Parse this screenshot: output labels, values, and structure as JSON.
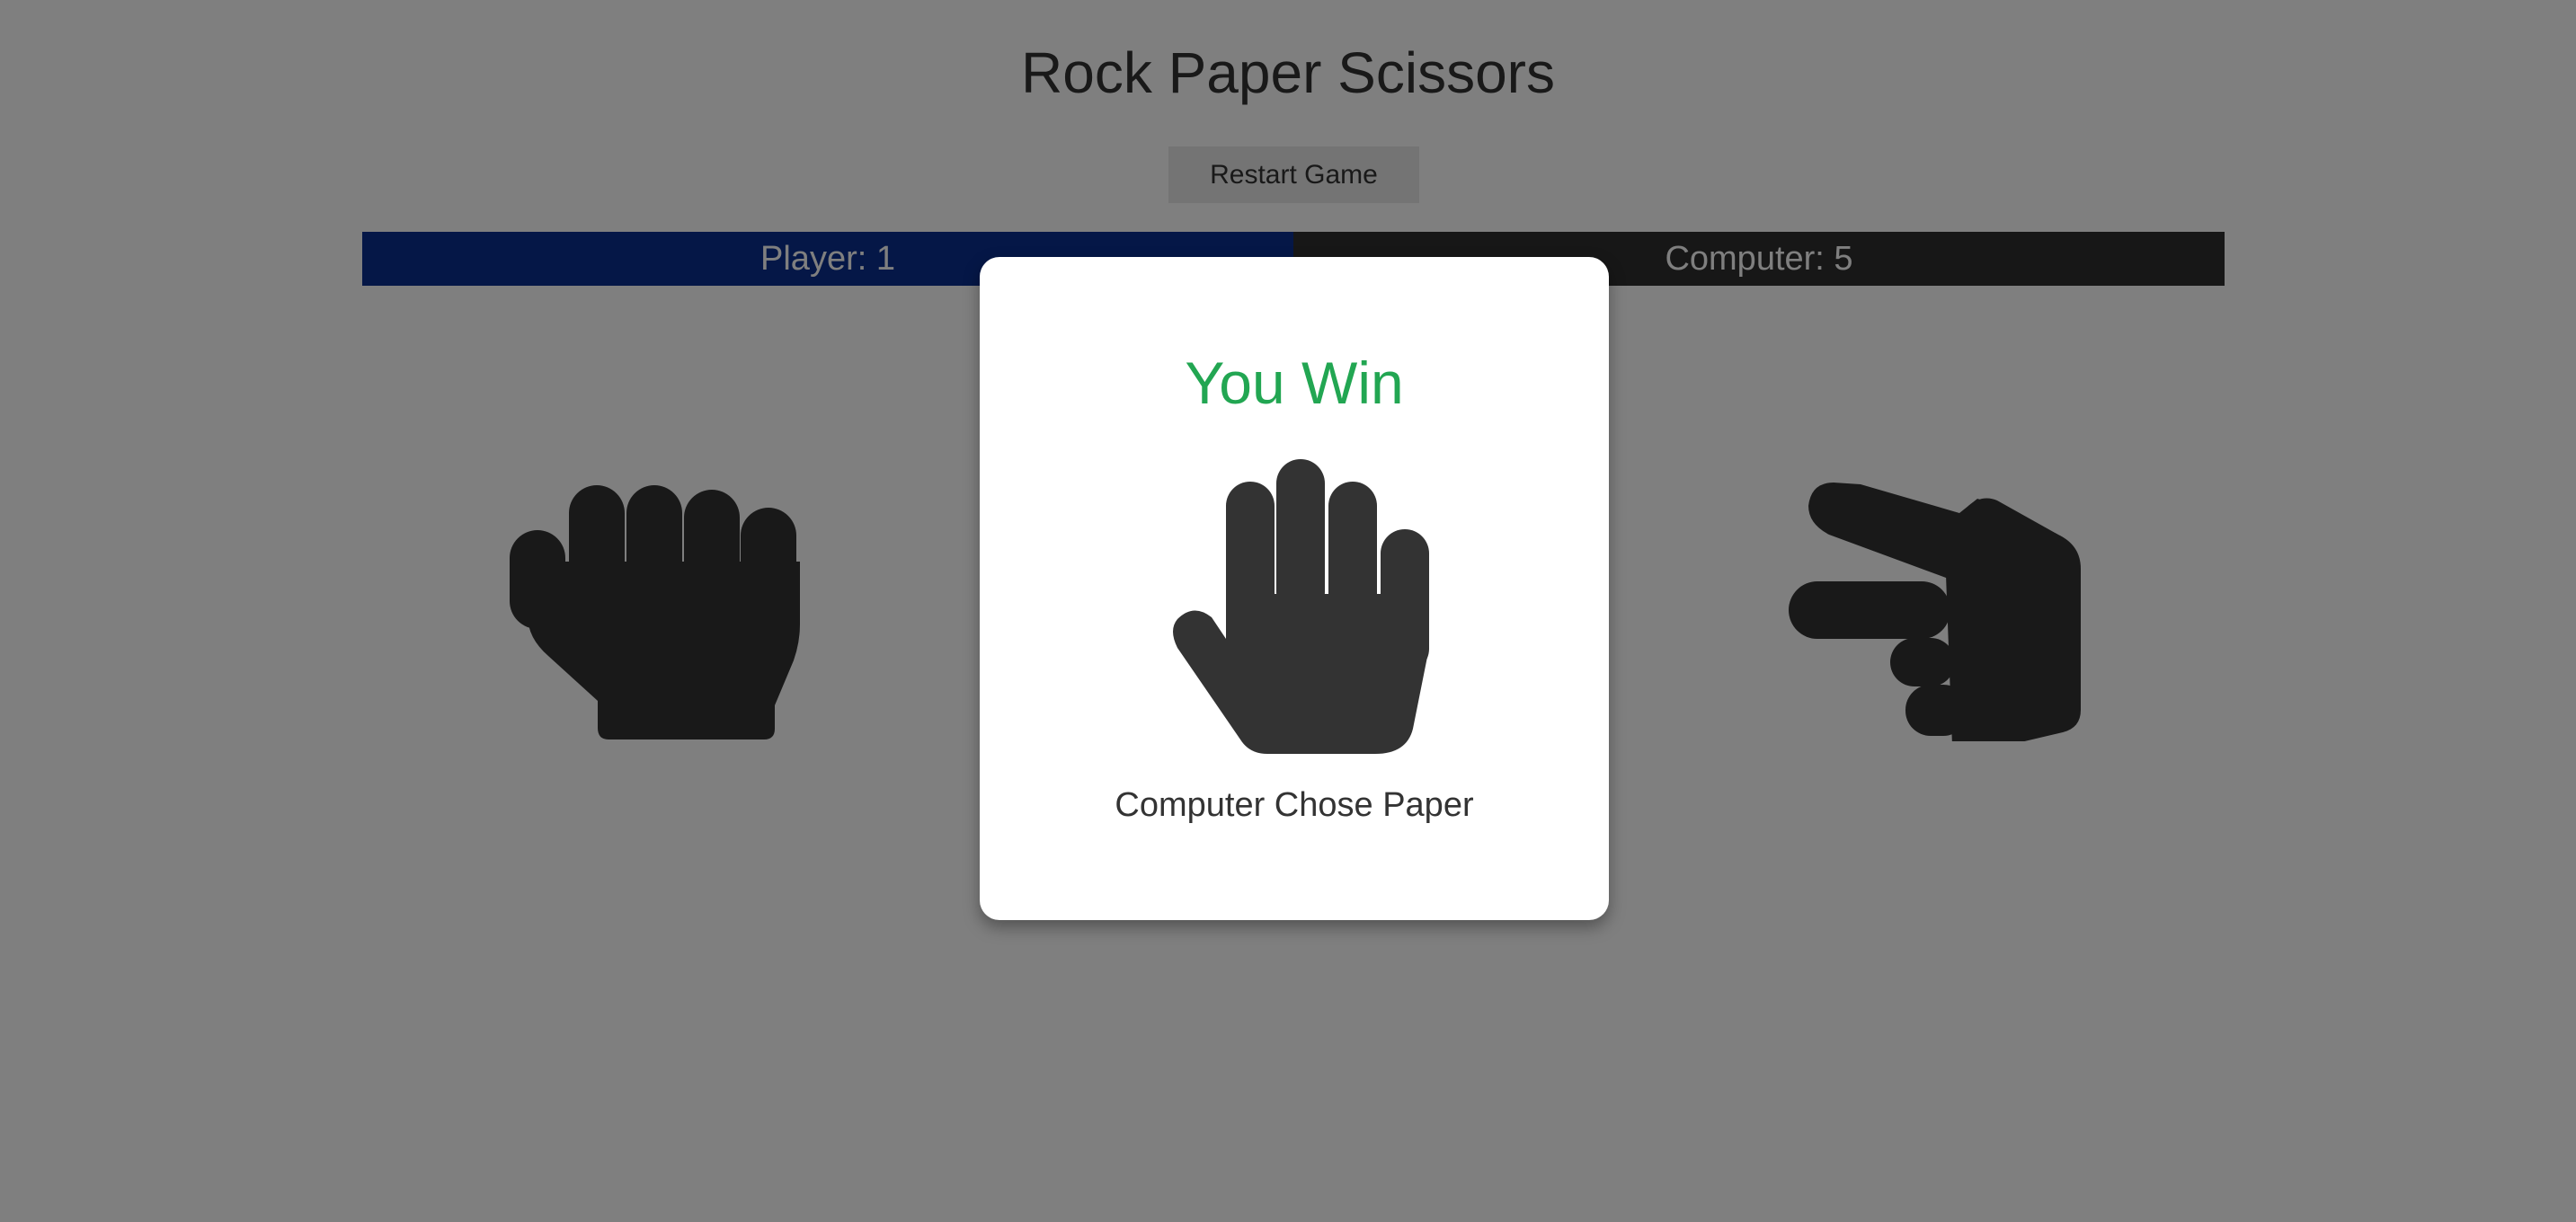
{
  "page": {
    "title": "Rock Paper Scissors",
    "restart_label": "Restart Game"
  },
  "score": {
    "player_label": "Player: 1",
    "computer_label": "Computer: 5",
    "player_color": "#0a2f8f",
    "computer_color": "#2f2f2f"
  },
  "choices": {
    "left": {
      "icon": "hand-rock-icon"
    },
    "right": {
      "icon": "hand-scissors-icon"
    }
  },
  "modal": {
    "result": "You Win",
    "result_color": "#22a652",
    "hand_icon": "hand-paper-icon",
    "prefix": "Computer Chose ",
    "choice": "Paper"
  },
  "colors": {
    "overlay": "rgba(0,0,0,0.5)",
    "icon": "#333333",
    "background": "#ffffff"
  }
}
